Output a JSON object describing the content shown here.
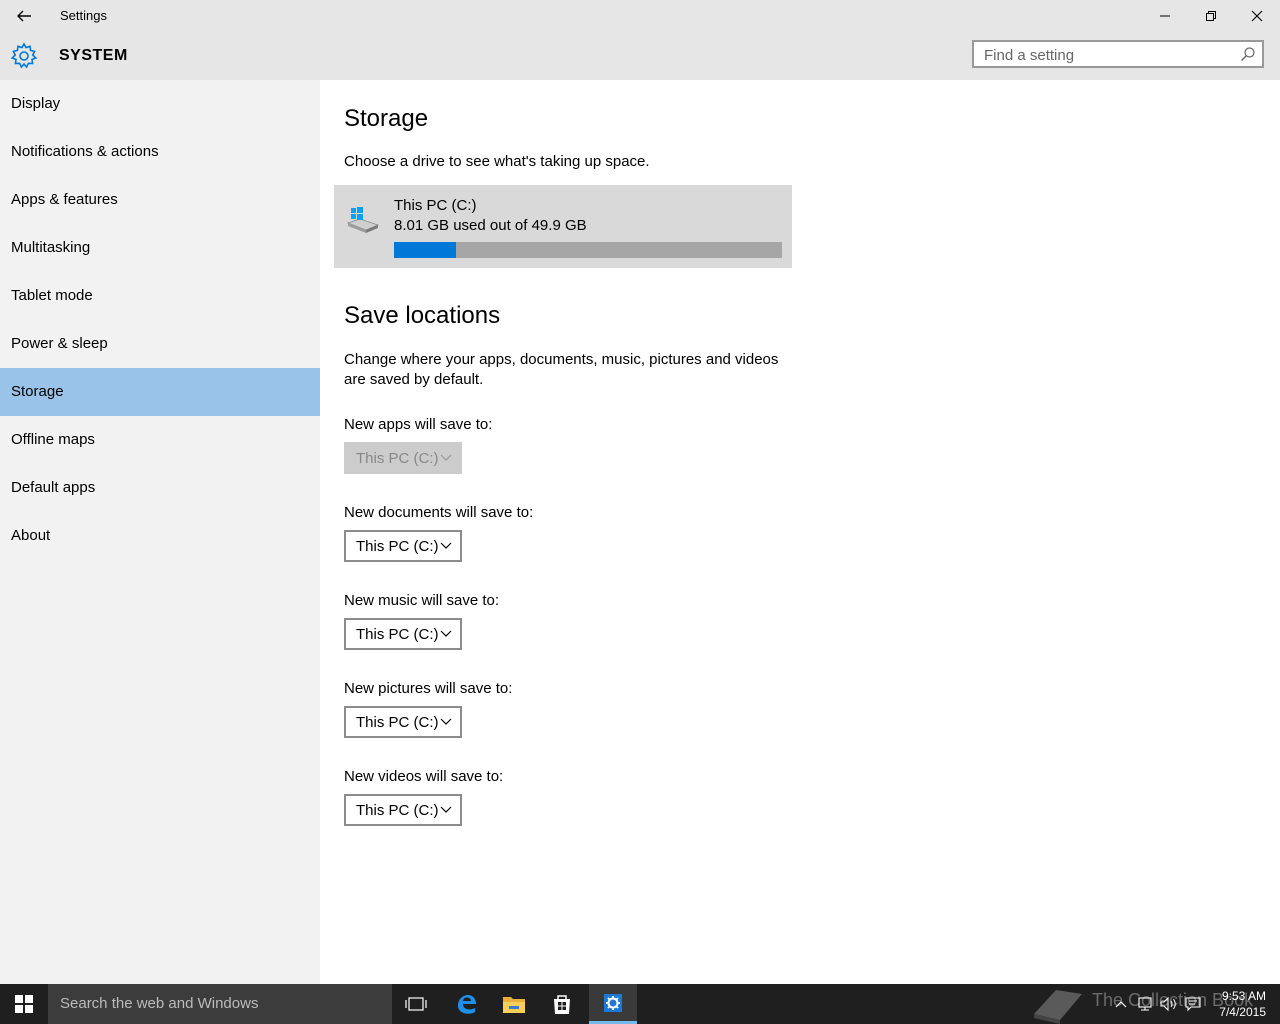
{
  "window": {
    "title": "Settings",
    "minimize_icon": "minimize-icon",
    "restore_icon": "restore-icon",
    "close_icon": "close-icon"
  },
  "header": {
    "section": "SYSTEM",
    "search_placeholder": "Find a setting"
  },
  "sidebar": {
    "items": [
      {
        "label": "Display"
      },
      {
        "label": "Notifications & actions"
      },
      {
        "label": "Apps & features"
      },
      {
        "label": "Multitasking"
      },
      {
        "label": "Tablet mode"
      },
      {
        "label": "Power & sleep"
      },
      {
        "label": "Storage",
        "active": true
      },
      {
        "label": "Offline maps"
      },
      {
        "label": "Default apps"
      },
      {
        "label": "About"
      }
    ]
  },
  "storage": {
    "title": "Storage",
    "subtitle": "Choose a drive to see what's taking up space.",
    "drive": {
      "name": "This PC (C:)",
      "usage_text": "8.01 GB used out of 49.9 GB",
      "used_gb": 8.01,
      "total_gb": 49.9
    }
  },
  "save_locations": {
    "title": "Save locations",
    "description": "Change where your apps, documents, music, pictures and videos are saved by default.",
    "apps_label": "New apps will save to:",
    "apps_value": "This PC (C:)",
    "documents_label": "New documents will save to:",
    "documents_value": "This PC (C:)",
    "music_label": "New music will save to:",
    "music_value": "This PC (C:)",
    "pictures_label": "New pictures will save to:",
    "pictures_value": "This PC (C:)",
    "videos_label": "New videos will save to:",
    "videos_value": "This PC (C:)"
  },
  "taskbar": {
    "search_text": "Search the web and Windows",
    "watermark": "The Collection Book",
    "time": "9:53 AM",
    "date": "7/4/2015"
  },
  "colors": {
    "accent": "#0078d7",
    "sidebar_active": "#99c3e8",
    "chrome": "#e6e6e6"
  }
}
